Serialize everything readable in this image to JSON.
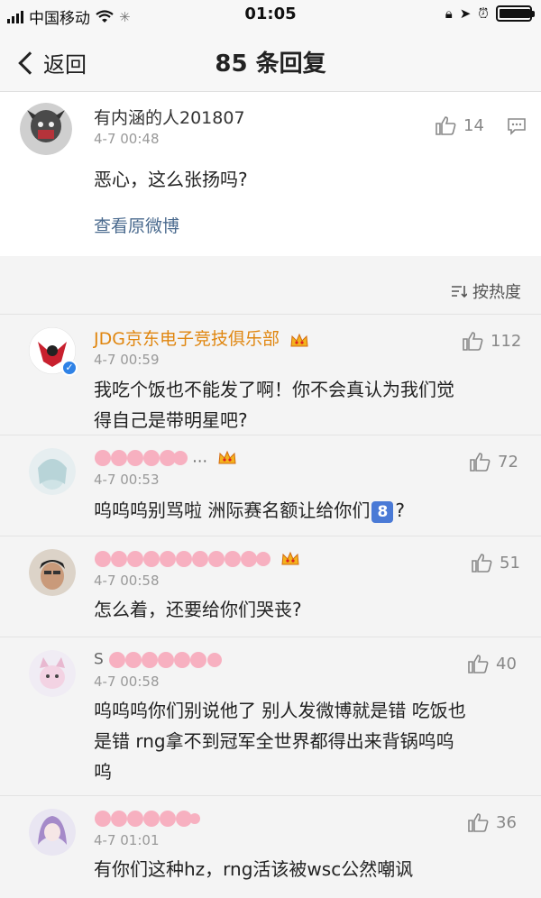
{
  "status_bar": {
    "carrier": "中国移动",
    "time": "01:05"
  },
  "nav": {
    "back_label": "返回",
    "title": "85 条回复"
  },
  "root_comment": {
    "author": "有内涵的人201807",
    "time": "4-7 00:48",
    "likes": "14",
    "text": "恶心，这么张扬吗?",
    "view_original": "查看原微博"
  },
  "sort": {
    "label": "按热度"
  },
  "replies": [
    {
      "author": "JDG京东电子竞技俱乐部",
      "time": "4-7 00:59",
      "likes": "112",
      "text_line1": "我吃个饭也不能发了啊！你不会真认为我们觉",
      "text_line2": "得自己是带明星吧?"
    },
    {
      "author_tail": "…",
      "time": "4-7 00:53",
      "likes": "72",
      "text_before": "呜呜呜别骂啦 洲际赛名额让给你们",
      "badge": "8",
      "text_after": "?"
    },
    {
      "author_tail": "",
      "time": "4-7 00:58",
      "likes": "51",
      "text_line1": "怎么着，还要给你们哭丧?"
    },
    {
      "author_tail": "S",
      "time": "4-7 00:58",
      "likes": "40",
      "text_line1": "呜呜呜你们别说他了 别人发微博就是错 吃饭也",
      "text_line2": "是错 rng拿不到冠军全世界都得出来背锅呜呜",
      "text_line3": "呜"
    },
    {
      "author_tail": "",
      "time": "4-7 01:01",
      "likes": "36",
      "text_line1": "有你们这种hz，rng活该被wsc公然嘲讽"
    }
  ],
  "colors": {
    "accent_orange": "#e0860f",
    "link_blue": "#4a6a8e",
    "badge_blue": "#4a7ad6"
  }
}
